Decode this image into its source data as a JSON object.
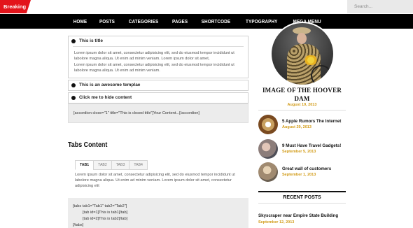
{
  "topbar": {
    "breaking_label": "Breaking",
    "search_placeholder": "Search..."
  },
  "nav": {
    "items": [
      "HOME",
      "POSTS",
      "CATEGORIES",
      "PAGES",
      "SHORTCODE",
      "TYPOGRAPHY",
      "MEGA MENU"
    ]
  },
  "accordion": {
    "items": [
      {
        "title": "This is title",
        "paragraphs": [
          "Lorem ipsum dolor sit amet, consectetur adipisicing elit, sed do eiusmod tempor incididunt ut labolore magna aliqua. Ut enim ad minim veniam. Lorem ipsum dolor sit amet,",
          "Lorem ipsum dolor sit amet, consectetur adipisicing elit, sed do eiusmod tempor incididunt ut labolore magna aliqua. Ut enim ad minim veniam."
        ]
      },
      {
        "title": "This is an awesome templae"
      },
      {
        "title": "Click me to hide content"
      }
    ],
    "code": "[accordion close=\"1\" title=\"This is closed title\"]Your Content...[/accordion]"
  },
  "tabs": {
    "title": "Tabs Content",
    "labels": [
      "TAB1",
      "TAB2",
      "TAB3",
      "TAB4"
    ],
    "content": "Lorem ipsum dolor sit amet, consectetur adipisicing elit, sed do eiusmod tempor incididunt ut labolore magna aliqua. Ut enim ad minim veniam. Lorem ipsum dolor sit amet, consectetur adipisicing elit",
    "code_lines": [
      "[tabs tab1=\"Tab1\" tab2=\"Tab2\"]",
      "[tab id=1]This is tab1[/tab]",
      "[tab id=2]This is tab2[/tab]",
      "[/tabs]"
    ]
  },
  "sidebar": {
    "featured": {
      "title": "IMAGE OF THE HOOVER DAM",
      "date": "August 19, 2013"
    },
    "posts": [
      {
        "title": "5 Apple Rumors The Internet",
        "date": "August 29, 2013",
        "icon": "donut-thumbnail"
      },
      {
        "title": "9 Must Have Travel Gadgets!",
        "date": "September 5, 2013",
        "icon": "portrait-thumbnail"
      },
      {
        "title": "Great wall of customers",
        "date": "September 1, 2013",
        "icon": "portrait-thumbnail"
      }
    ],
    "recent": {
      "heading": "RECENT POSTS",
      "item_title": "Skyscraper near Empire State Building",
      "item_date": "September 12, 2013"
    }
  },
  "colors": {
    "accent_red": "#e3141b",
    "date_gold": "#d19a15",
    "nav_bg": "#000000"
  }
}
